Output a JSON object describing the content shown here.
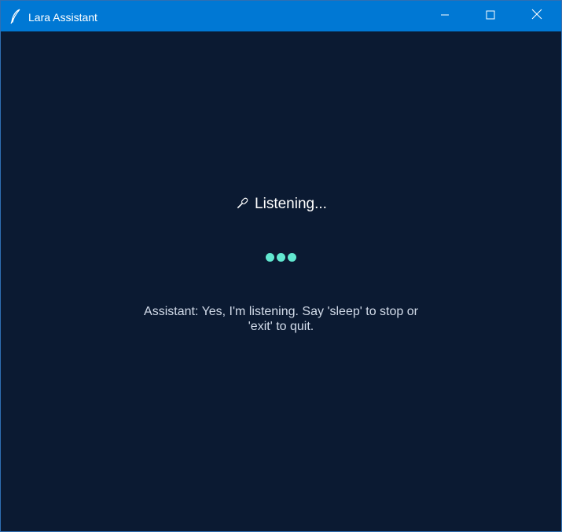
{
  "window": {
    "title": "Lara Assistant",
    "app_icon": "feather-icon",
    "controls": {
      "minimize_icon": "minimize-icon",
      "maximize_icon": "maximize-icon",
      "close_icon": "close-icon"
    }
  },
  "status": {
    "icon": "microphone-icon",
    "text": "Listening..."
  },
  "activity_indicator": {
    "dot_count": 3,
    "color": "#62e8d0"
  },
  "message": {
    "text": "Assistant: Yes, I'm listening. Say 'sleep' to stop or 'exit' to quit."
  },
  "colors": {
    "titlebar": "#0078d4",
    "background": "#0b1a32",
    "accent": "#62e8d0"
  }
}
